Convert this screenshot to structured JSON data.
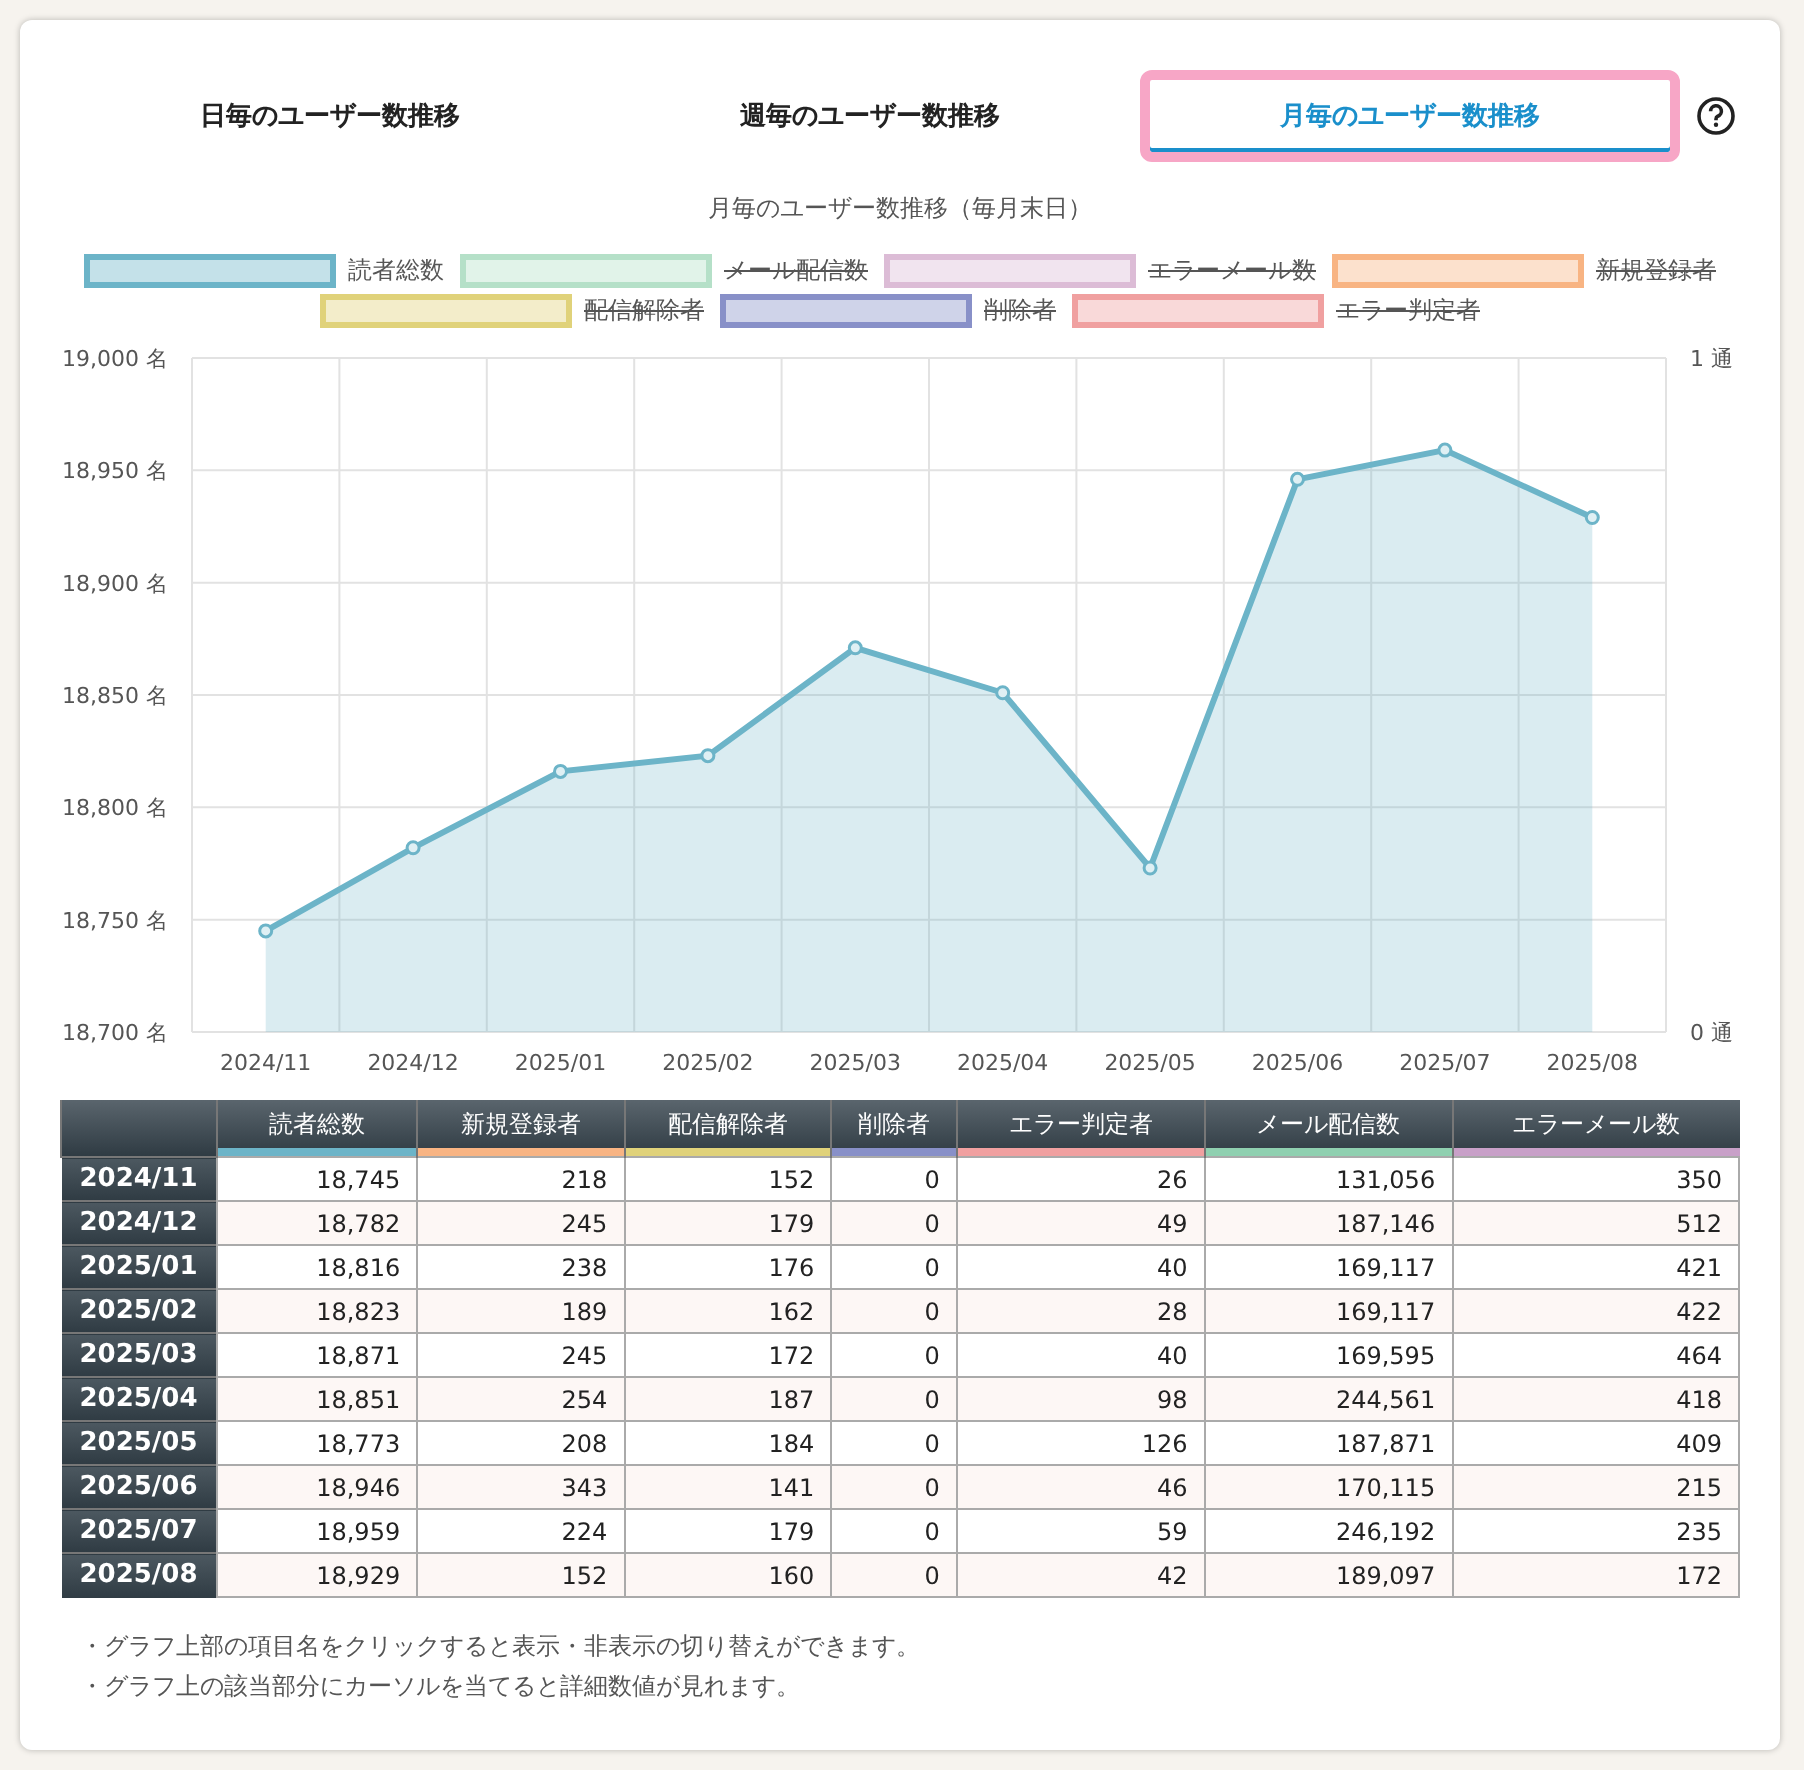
{
  "tabs": [
    {
      "label": "日毎のユーザー数推移",
      "selected": false
    },
    {
      "label": "週毎のユーザー数推移",
      "selected": false
    },
    {
      "label": "月毎のユーザー数推移",
      "selected": true
    }
  ],
  "chart_title": "月毎のユーザー数推移（毎月末日）",
  "right_axis": [
    "1 通",
    "0 通"
  ],
  "chart_data": {
    "type": "area",
    "categories": [
      "2024/11",
      "2024/12",
      "2025/01",
      "2025/02",
      "2025/03",
      "2025/04",
      "2025/05",
      "2025/06",
      "2025/07",
      "2025/08"
    ],
    "grid": true,
    "series": [
      {
        "name": "読者総数",
        "color": "#6cb4c8",
        "values": [
          18745,
          18782,
          18816,
          18823,
          18871,
          18851,
          18773,
          18946,
          18959,
          18929
        ]
      }
    ],
    "ylim": [
      18700,
      19000
    ],
    "yticks": [
      {
        "value": 18700,
        "label": "18,700 名"
      },
      {
        "value": 18750,
        "label": "18,750 名"
      },
      {
        "value": 18800,
        "label": "18,800 名"
      },
      {
        "value": 18850,
        "label": "18,850 名"
      },
      {
        "value": 18900,
        "label": "18,900 名"
      },
      {
        "value": 18950,
        "label": "18,950 名"
      },
      {
        "value": 19000,
        "label": "19,000 名"
      }
    ]
  },
  "legend": [
    {
      "kind": "series",
      "hidden": false
    },
    {
      "kind": "label",
      "label": "メール配信数",
      "color": "#b5e0c8",
      "hidden": true
    },
    {
      "kind": "label",
      "label": "エラーメール数",
      "color": "#dcbcd6",
      "hidden": true
    },
    {
      "kind": "label",
      "label": "新規登録者",
      "color": "#f8b483",
      "hidden": true
    },
    {
      "kind": "label",
      "label": "配信解除者",
      "color": "#e0d27a",
      "hidden": true
    },
    {
      "kind": "label",
      "label": "削除者",
      "color": "#8890c8",
      "hidden": true
    },
    {
      "kind": "label",
      "label": "エラー判定者",
      "color": "#f0a0a0",
      "hidden": true
    }
  ],
  "table": {
    "columns": [
      {
        "label": "読者総数",
        "color": "#6cb4c8"
      },
      {
        "label": "新規登録者",
        "color": "#f8b483"
      },
      {
        "label": "配信解除者",
        "color": "#e0d27a"
      },
      {
        "label": "削除者",
        "color": "#8890c8"
      },
      {
        "label": "エラー判定者",
        "color": "#f0a0a0"
      },
      {
        "label": "メール配信数",
        "color": "#8fd0b0"
      },
      {
        "label": "エラーメール数",
        "color": "#c8a0c8"
      }
    ],
    "rows": [
      {
        "month": "2024/11",
        "cells": [
          "18,745",
          "218",
          "152",
          "0",
          "26",
          "131,056",
          "350"
        ]
      },
      {
        "month": "2024/12",
        "cells": [
          "18,782",
          "245",
          "179",
          "0",
          "49",
          "187,146",
          "512"
        ]
      },
      {
        "month": "2025/01",
        "cells": [
          "18,816",
          "238",
          "176",
          "0",
          "40",
          "169,117",
          "421"
        ]
      },
      {
        "month": "2025/02",
        "cells": [
          "18,823",
          "189",
          "162",
          "0",
          "28",
          "169,117",
          "422"
        ]
      },
      {
        "month": "2025/03",
        "cells": [
          "18,871",
          "245",
          "172",
          "0",
          "40",
          "169,595",
          "464"
        ]
      },
      {
        "month": "2025/04",
        "cells": [
          "18,851",
          "254",
          "187",
          "0",
          "98",
          "244,561",
          "418"
        ]
      },
      {
        "month": "2025/05",
        "cells": [
          "18,773",
          "208",
          "184",
          "0",
          "126",
          "187,871",
          "409"
        ]
      },
      {
        "month": "2025/06",
        "cells": [
          "18,946",
          "343",
          "141",
          "0",
          "46",
          "170,115",
          "215"
        ]
      },
      {
        "month": "2025/07",
        "cells": [
          "18,959",
          "224",
          "179",
          "0",
          "59",
          "246,192",
          "235"
        ]
      },
      {
        "month": "2025/08",
        "cells": [
          "18,929",
          "152",
          "160",
          "0",
          "42",
          "189,097",
          "172"
        ]
      }
    ]
  },
  "notes": [
    "・グラフ上部の項目名をクリックすると表示・非表示の切り替えができます。",
    "・グラフ上の該当部分にカーソルを当てると詳細数値が見れます。"
  ]
}
